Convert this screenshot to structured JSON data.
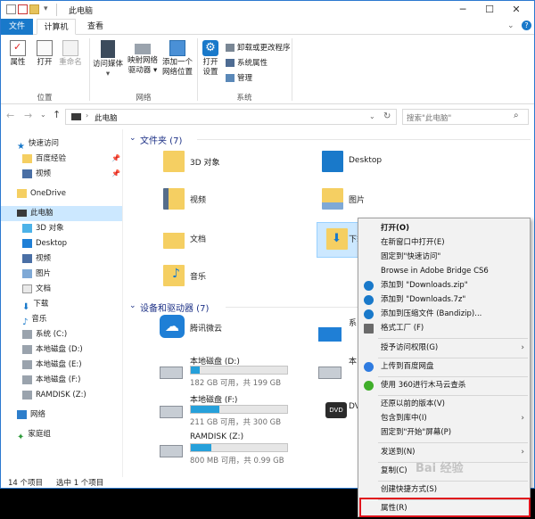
{
  "titlebar": {
    "title": "此电脑",
    "minimize": "─",
    "maximize": "☐",
    "close": "✕"
  },
  "ribbon_tabs": [
    "文件",
    "计算机",
    "查看"
  ],
  "ribbon": {
    "location_group": "位置",
    "network_group": "网络",
    "system_group": "系统",
    "btn_properties": "属性",
    "btn_open": "打开",
    "btn_rename": "重命名",
    "btn_media": "访问媒体",
    "btn_map1": "映射网络",
    "btn_map2": "驱动器",
    "btn_addloc1": "添加一个",
    "btn_addloc2": "网络位置",
    "btn_settings1": "打开",
    "btn_settings2": "设置",
    "btn_uninstall": "卸载或更改程序",
    "btn_sysprops": "系统属性",
    "btn_manage": "管理"
  },
  "address": {
    "path": "此电脑",
    "search_placeholder": "搜索\"此电脑\""
  },
  "nav": {
    "quick": "快速访问",
    "baidu": "百度经验",
    "video1": "视频",
    "onedrive": "OneDrive",
    "thispc": "此电脑",
    "d3": "3D 对象",
    "desktop": "Desktop",
    "video2": "视频",
    "pictures": "图片",
    "docs": "文档",
    "downloads": "下载",
    "music": "音乐",
    "sysc": "系统 (C:)",
    "locd": "本地磁盘 (D:)",
    "loce": "本地磁盘 (E:)",
    "locf": "本地磁盘 (F:)",
    "ramdisk": "RAMDISK (Z:)",
    "network": "网络",
    "homegroup": "家庭组"
  },
  "folders": {
    "header": "文件夹 (7)",
    "f1": "3D 对象",
    "f2": "Desktop",
    "f3": "视频",
    "f4": "图片",
    "f5": "文档",
    "f6": "下载",
    "f7": "音乐"
  },
  "drives": {
    "header": "设备和驱动器 (7)",
    "tencent": "腾讯微云",
    "d_label": "本地磁盘 (D:)",
    "d_free": "182 GB 可用，共 199 GB",
    "d_used": 0.09,
    "f_label": "本地磁盘 (F:)",
    "f_free": "211 GB 可用，共 300 GB",
    "f_used": 0.3,
    "z_label": "RAMDISK (Z:)",
    "z_free": "800 MB 可用，共 0.99 GB",
    "z_used": 0.21,
    "sys_partial": "系",
    "loc_partial": "本",
    "dvd_partial": "DV"
  },
  "status": {
    "count": "14 个项目",
    "selected": "选中 1 个项目"
  },
  "context_menu": {
    "open": "打开(O)",
    "new_window": "在新窗口中打开(E)",
    "pin_quick": "固定到\"快速访问\"",
    "bridge": "Browse in Adobe Bridge CS6",
    "zip": "添加到 \"Downloads.zip\"",
    "z7": "添加到 \"Downloads.7z\"",
    "bandizip": "添加到压缩文件 (Bandizip)...",
    "format_factory": "格式工厂 (F)",
    "grant": "授予访问权限(G)",
    "baidu_upload": "上传到百度网盘",
    "scan360": "使用 360进行木马云查杀",
    "restore": "还原以前的版本(V)",
    "library": "包含到库中(I)",
    "pin_start": "固定到\"开始\"屏幕(P)",
    "send_to": "发送到(N)",
    "copy": "复制(C)",
    "shortcut": "创建快捷方式(S)",
    "properties": "属性(R)"
  },
  "watermark": "Bai 经验",
  "colors": {
    "accent": "#1979ca",
    "highlight": "#e0141c"
  }
}
